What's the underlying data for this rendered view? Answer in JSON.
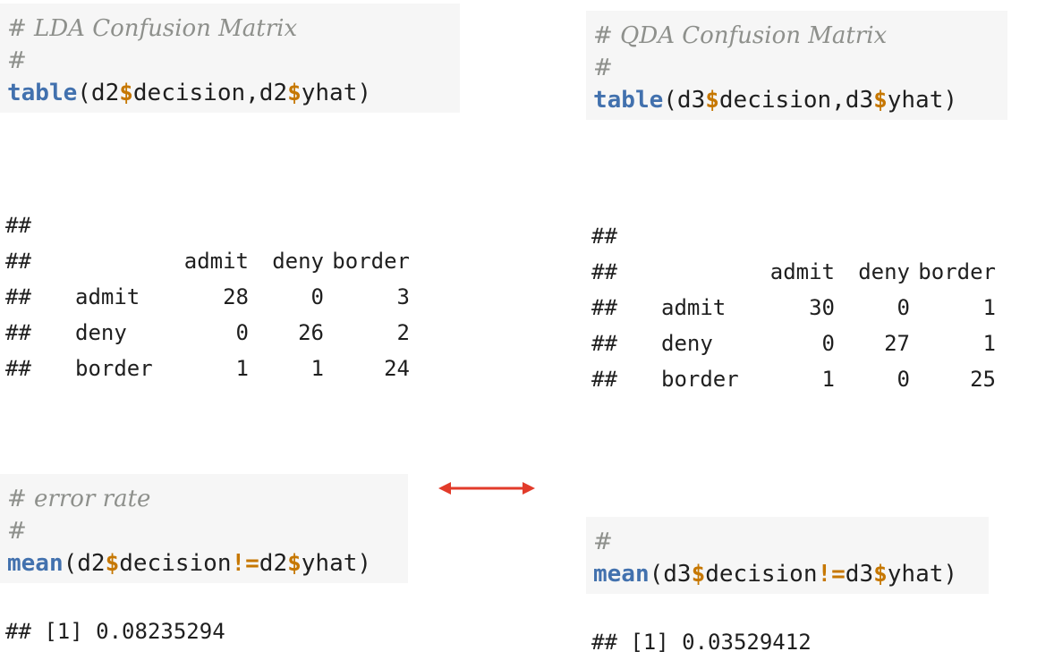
{
  "left": {
    "code1": {
      "comment1": "# LDA Confusion Matrix",
      "comment2": "#",
      "fn": "table",
      "open": "(d2",
      "op1": "$",
      "mid": "decision,d2",
      "op2": "$",
      "end": "yhat)"
    },
    "output1": {
      "prefix": "##",
      "col_headers": [
        "admit",
        "deny",
        "border"
      ],
      "rows": [
        {
          "label": "admit",
          "values": [
            "28",
            "0",
            "3"
          ]
        },
        {
          "label": "deny",
          "values": [
            "0",
            "26",
            "2"
          ]
        },
        {
          "label": "border",
          "values": [
            "1",
            "1",
            "24"
          ]
        }
      ]
    },
    "code2": {
      "comment1": "# error rate",
      "comment2": "#",
      "fn": "mean",
      "open": "(d2",
      "op1": "$",
      "mid": "decision",
      "op2": "!=",
      "mid2": "d2",
      "op3": "$",
      "end": "yhat)"
    },
    "result": "## [1] 0.08235294"
  },
  "right": {
    "code1": {
      "comment1": "# QDA Confusion Matrix",
      "comment2": "#",
      "fn": "table",
      "open": "(d3",
      "op1": "$",
      "mid": "decision,d3",
      "op2": "$",
      "end": "yhat)"
    },
    "output1": {
      "prefix": "##",
      "col_headers": [
        "admit",
        "deny",
        "border"
      ],
      "rows": [
        {
          "label": "admit",
          "values": [
            "30",
            "0",
            "1"
          ]
        },
        {
          "label": "deny",
          "values": [
            "0",
            "27",
            "1"
          ]
        },
        {
          "label": "border",
          "values": [
            "1",
            "0",
            "25"
          ]
        }
      ]
    },
    "code2": {
      "comment1": "#",
      "fn": "mean",
      "open": "(d3",
      "op1": "$",
      "mid": "decision",
      "op2": "!=",
      "mid2": "d3",
      "op3": "$",
      "end": "yhat)"
    },
    "result": "## [1] 0.03529412"
  },
  "colors": {
    "arrow": "#e23b2a",
    "code_bg": "#f6f6f6",
    "fn": "#4271ae",
    "op": "#c67700",
    "comment": "#8e908c"
  },
  "icons": {
    "comparison_arrow": "double-headed-arrow-icon"
  }
}
